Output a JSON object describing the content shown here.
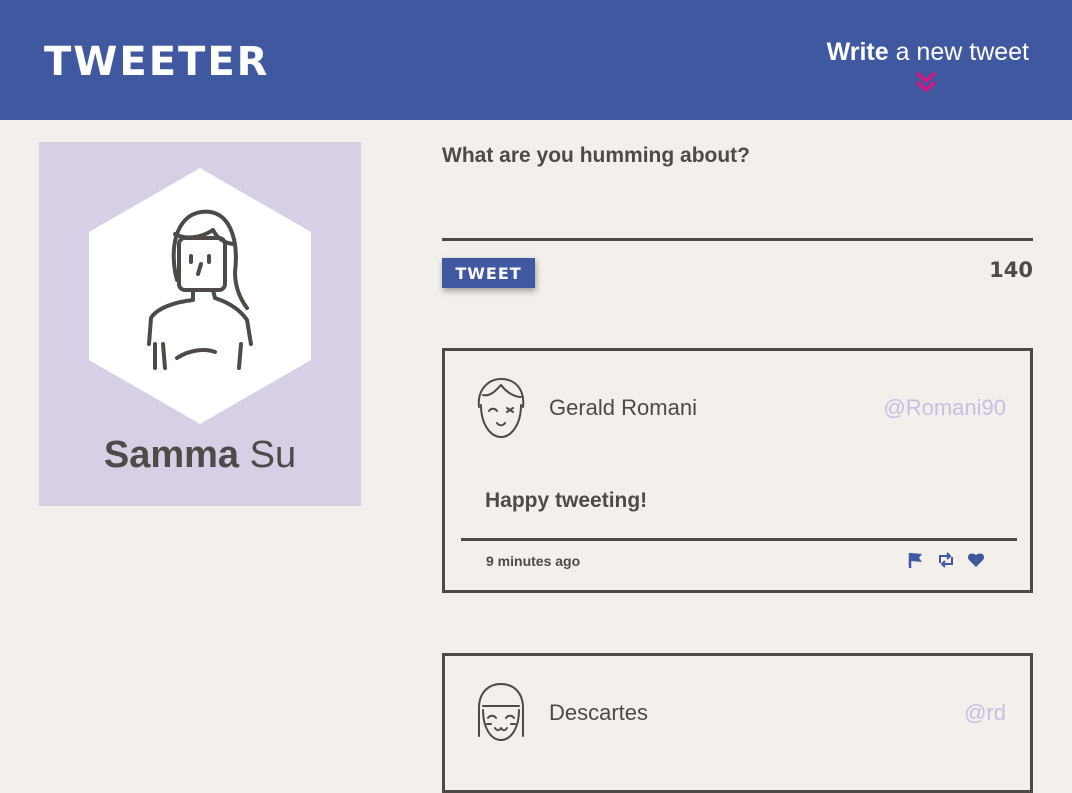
{
  "nav": {
    "logo": "TWEETER",
    "compose_bold": "Write",
    "compose_rest": " a new tweet",
    "brand_color": "#40589f",
    "accent_color": "#d6187f"
  },
  "profile": {
    "first_name": "Samma",
    "last_name": " Su",
    "panel_color": "#d6cfe6"
  },
  "composer": {
    "prompt": "What are you humming about?",
    "button_label": "TWEET",
    "counter": "140"
  },
  "tweets": [
    {
      "name": "Gerald Romani",
      "handle": "@Romani90",
      "content": "Happy tweeting!",
      "time": "9 minutes ago",
      "actions": [
        "flag-icon",
        "retweet-icon",
        "heart-icon"
      ]
    },
    {
      "name": "Descartes",
      "handle": "@rd"
    }
  ]
}
